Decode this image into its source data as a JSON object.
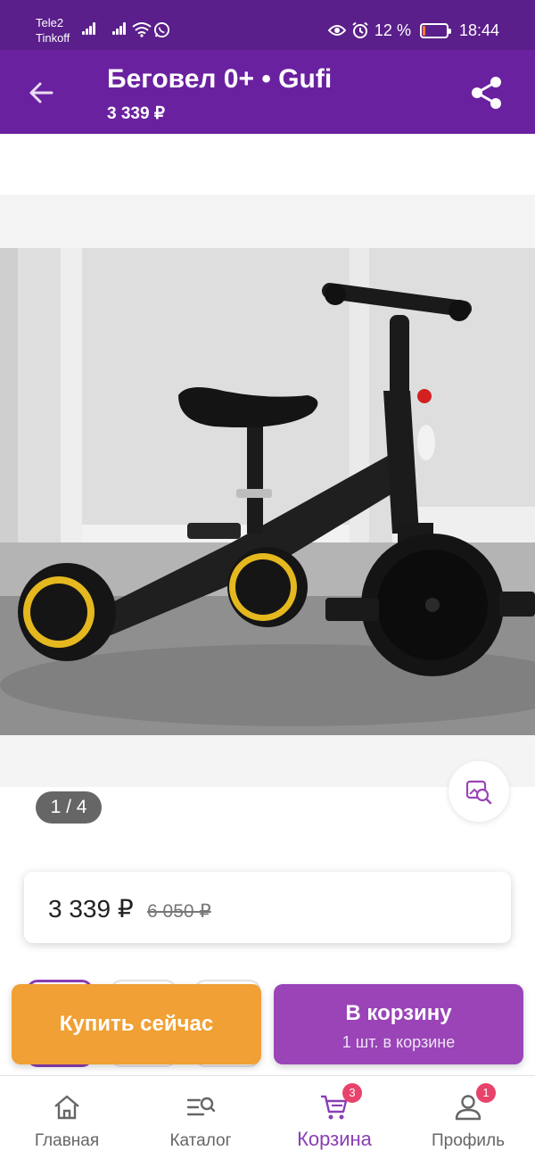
{
  "status_bar": {
    "carrier_1": "Tele2",
    "carrier_2": "Tinkoff",
    "battery_percent": "12 %",
    "battery_level": 0.12,
    "time": "18:44"
  },
  "header": {
    "title": "Беговел 0+ • Gufi",
    "price": "3 339 ₽",
    "back_icon": "arrow-left-icon",
    "share_icon": "share-icon",
    "background": "#6a21a0"
  },
  "gallery": {
    "counter": "1 / 4",
    "zoom_icon": "image-search-icon"
  },
  "price_card": {
    "current_price": "3 339 ₽",
    "old_price": "6 050 ₽"
  },
  "actions": {
    "buy_now_label": "Купить сейчас",
    "buy_color": "#f0a034",
    "add_to_cart_label": "В корзину",
    "in_cart_note": "1 шт. в корзине",
    "cart_color": "#9a44b8"
  },
  "bottom_nav": {
    "items": [
      {
        "label": "Главная",
        "icon": "home-icon",
        "active": false,
        "badge": ""
      },
      {
        "label": "Каталог",
        "icon": "catalog-search-icon",
        "active": false,
        "badge": ""
      },
      {
        "label": "Корзина",
        "icon": "cart-icon",
        "active": true,
        "badge": "3"
      },
      {
        "label": "Профиль",
        "icon": "profile-icon",
        "active": false,
        "badge": "1"
      }
    ],
    "accent_color": "#8a3fb4",
    "badge_color": "#e8436b"
  }
}
